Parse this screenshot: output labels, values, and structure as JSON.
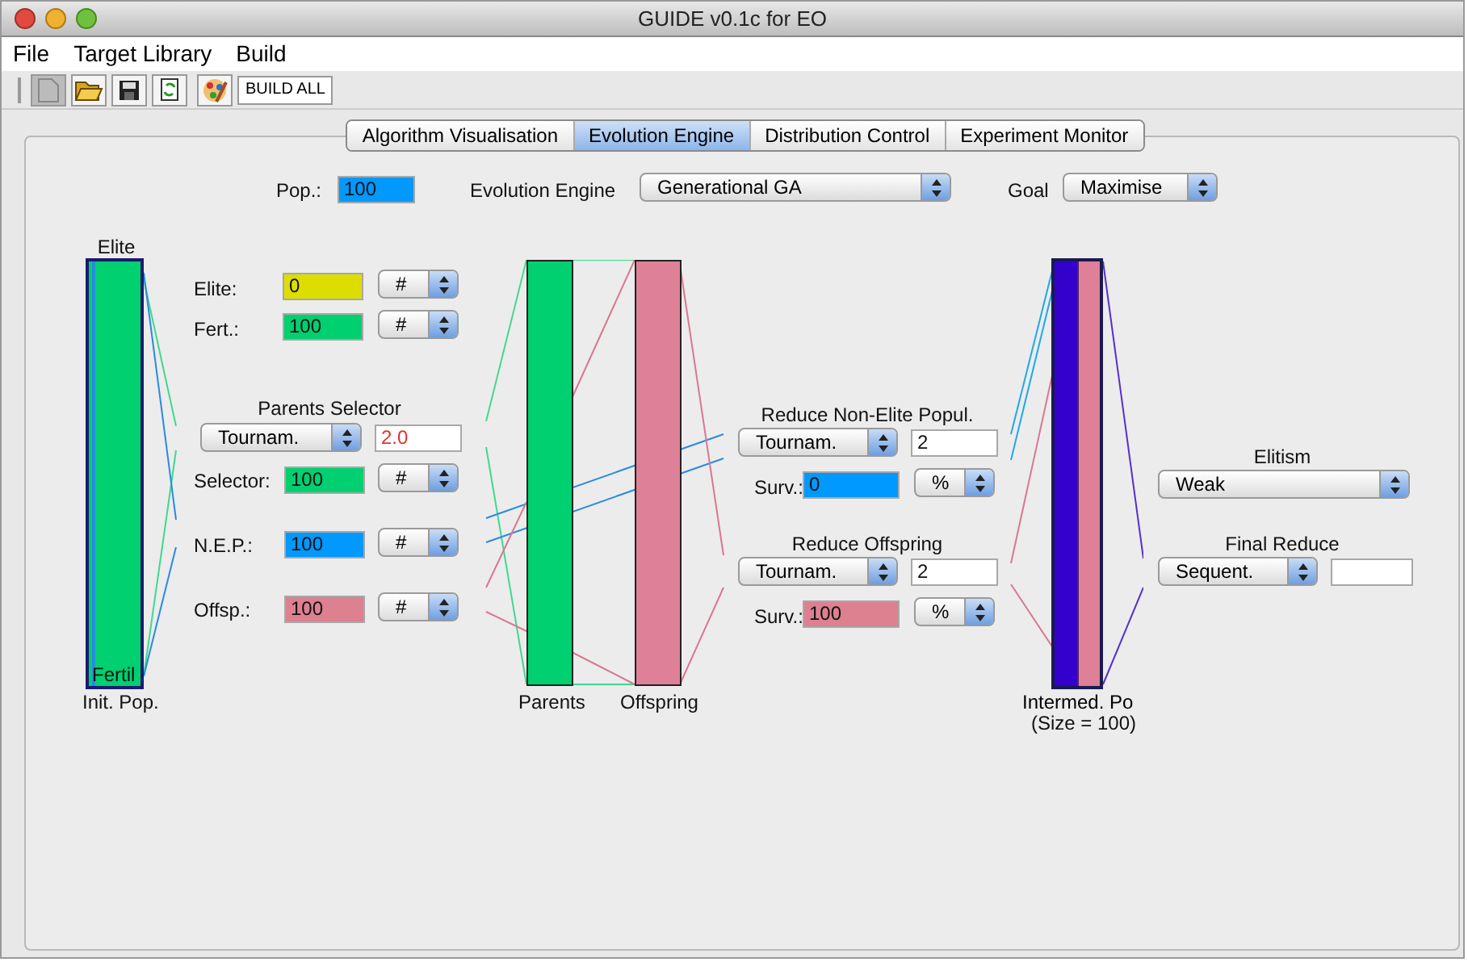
{
  "window": {
    "title": "GUIDE v0.1c for EO"
  },
  "menu": [
    "File",
    "Target Library",
    "Build"
  ],
  "toolbar": {
    "buttons": [
      {
        "disabled": true
      },
      {
        "disabled": false
      },
      {
        "disabled": false
      },
      {
        "disabled": false
      },
      {
        "disabled": false
      }
    ],
    "build_all": "BUILD ALL"
  },
  "tabs": [
    {
      "label": "Algorithm Visualisation",
      "selected": false
    },
    {
      "label": "Evolution Engine",
      "selected": true
    },
    {
      "label": "Distribution Control",
      "selected": false
    },
    {
      "label": "Experiment Monitor",
      "selected": false
    }
  ],
  "top": {
    "pop_label": "Pop.:",
    "pop_value": "100",
    "engine_label": "Evolution Engine",
    "engine_value": "Generational GA",
    "goal_label": "Goal",
    "goal_value": "Maximise"
  },
  "init_pop": {
    "top_label": "Elite",
    "inner_label": "Fertil",
    "label": "Init. Pop."
  },
  "counts": [
    {
      "label": "Elite:",
      "value": "0",
      "color": "#dddd00",
      "unit": "#"
    },
    {
      "label": "Fert.:",
      "value": "100",
      "color": "#00d070",
      "unit": "#"
    }
  ],
  "parents_selector": {
    "title": "Parents Selector",
    "method": "Tournam.",
    "parameter": "2.0"
  },
  "selector_counts": [
    {
      "label": "Selector:",
      "value": "100",
      "color": "#00d070",
      "unit": "#"
    },
    {
      "label": "N.E.P.:",
      "value": "100",
      "color": "#0099ff",
      "unit": "#"
    },
    {
      "label": "Offsp.:",
      "value": "100",
      "color": "#dd8090",
      "unit": "#"
    }
  ],
  "parents": {
    "label": "Parents"
  },
  "offspring": {
    "label": "Offspring"
  },
  "reducers": [
    {
      "title": "Reduce Non-Elite Popul.",
      "method": "Tournam.",
      "parameter": "2",
      "surv_label": "Surv.:",
      "surv_value": "0",
      "color": "#0099ff",
      "unit": "%"
    },
    {
      "title": "Reduce Offspring",
      "method": "Tournam.",
      "parameter": "2",
      "surv_label": "Surv.:",
      "surv_value": "100",
      "color": "#dd8090",
      "unit": "%"
    }
  ],
  "intermediate": {
    "label": "Intermed. Po",
    "size": "(Size = 100)"
  },
  "elitism": {
    "title": "Elitism",
    "value": "Weak"
  },
  "final_reduce": {
    "title": "Final Reduce",
    "method": "Sequent."
  }
}
